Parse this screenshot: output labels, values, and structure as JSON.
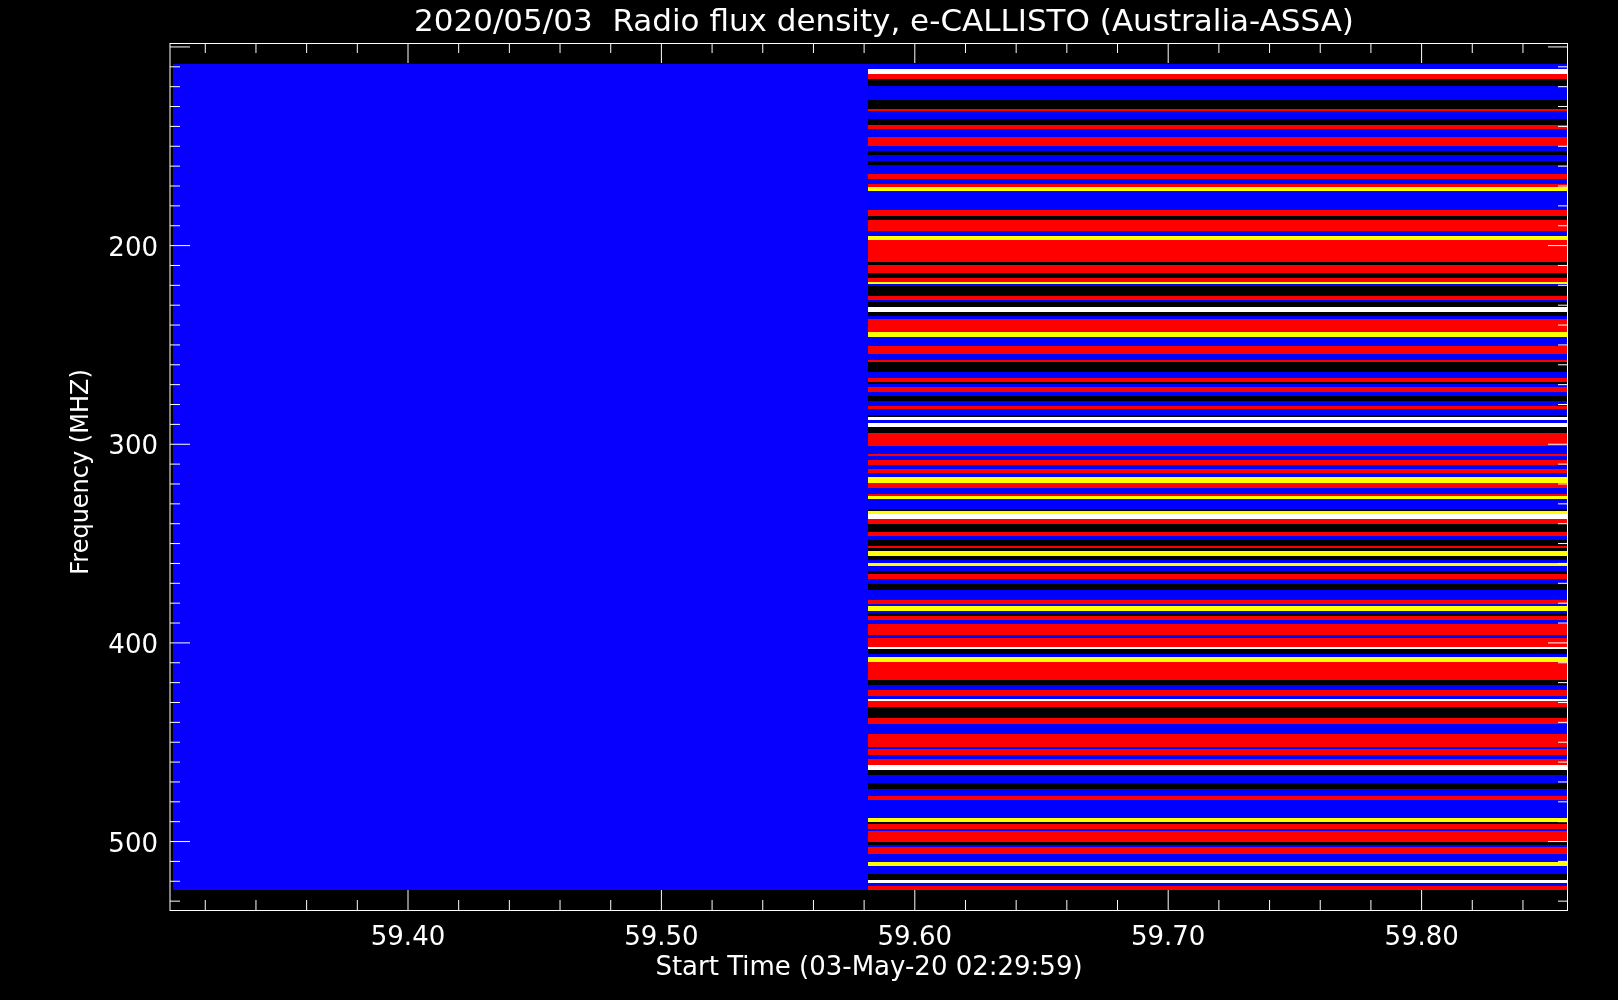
{
  "title": "2020/05/03  Radio flux density, e-CALLISTO (Australia-ASSA)",
  "y_axis": {
    "label": "Frequency (MHZ)",
    "ticks": [
      "200",
      "300",
      "400",
      "500"
    ]
  },
  "x_axis": {
    "label": "Start Time (03-May-20 02:29:59)",
    "ticks": [
      "59.40",
      "59.50",
      "59.60",
      "59.70",
      "59.80"
    ]
  }
}
